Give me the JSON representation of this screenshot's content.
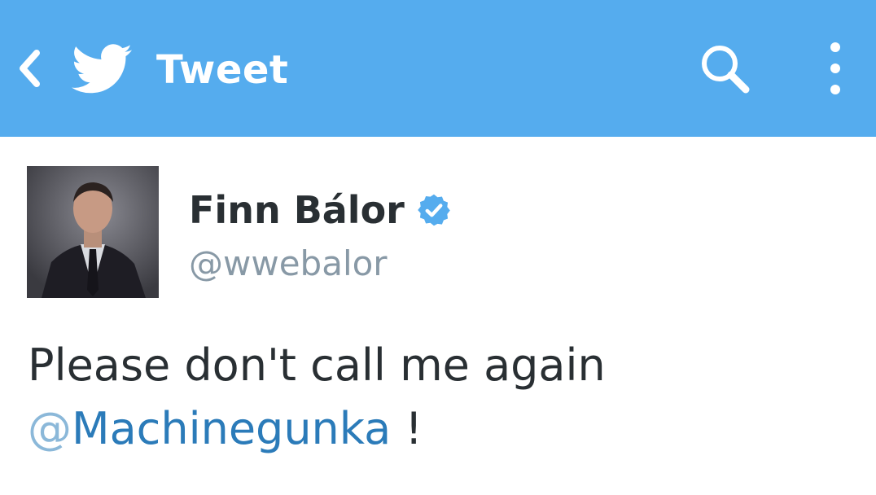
{
  "header": {
    "title": "Tweet",
    "back_icon": "chevron-left-icon",
    "logo_icon": "twitter-bird-icon",
    "search_icon": "search-icon",
    "menu_icon": "more-vertical-icon",
    "background_color": "#55acee"
  },
  "tweet": {
    "author_name": "Finn Bálor",
    "verified": true,
    "handle": "@wwebalor",
    "text_line1": "Please don't call me again",
    "mention_at": "@",
    "mention_name": "Machinegunka",
    "text_suffix": " !"
  },
  "colors": {
    "text": "#292f33",
    "handle": "#8899a6",
    "link": "#2b7bb9",
    "verified": "#55acee"
  }
}
